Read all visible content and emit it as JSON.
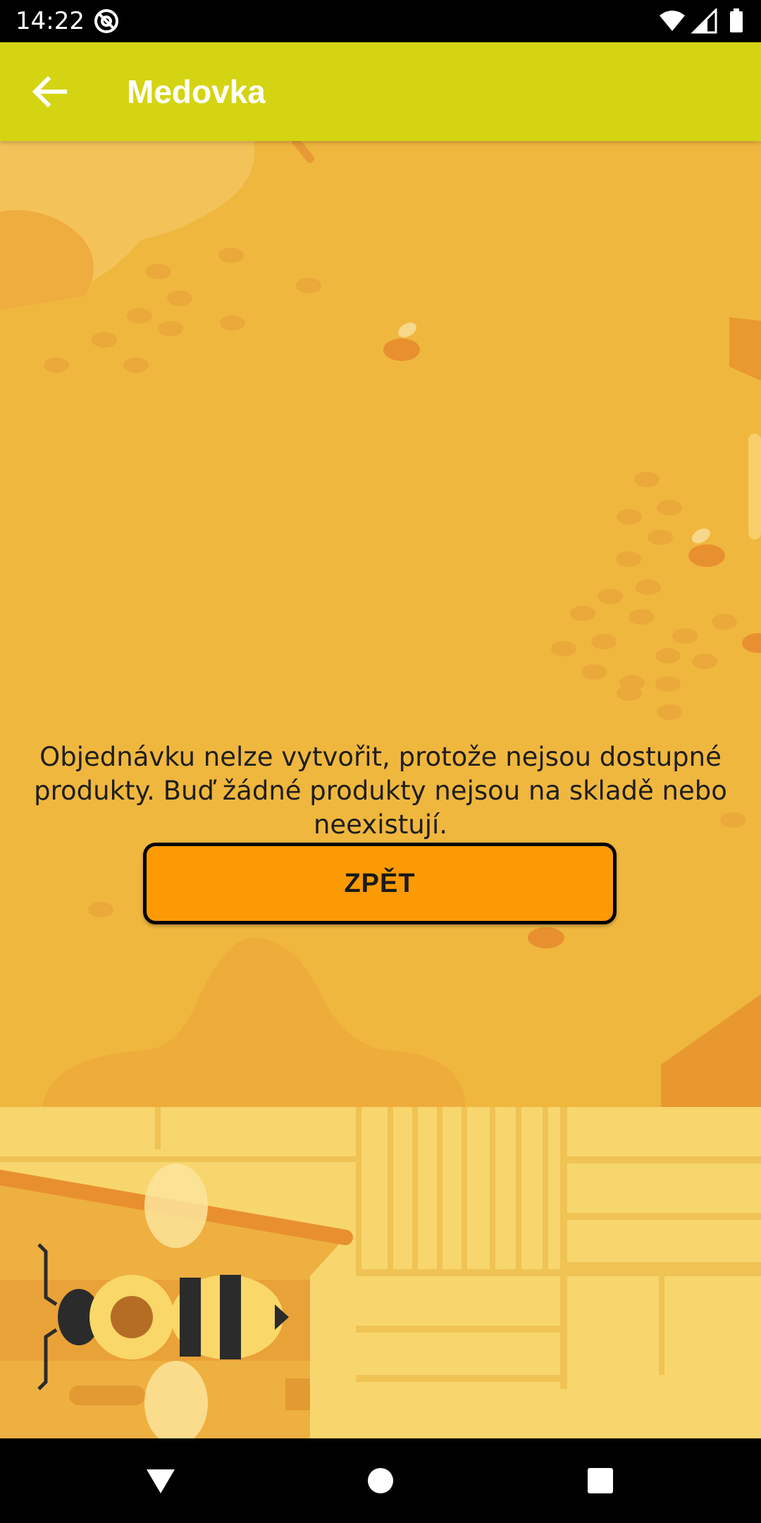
{
  "status_bar": {
    "time": "14:22"
  },
  "app_bar": {
    "title": "Medovka",
    "back_icon": "arrow-left-icon"
  },
  "content": {
    "message": "Objednávku nelze vytvořit, protože nejsou dostupné produkty. Buď žádné produkty nejsou na skladě nebo neexistují.",
    "back_button_label": "ZPĚT"
  },
  "nav_bar": {
    "icons": [
      "back-triangle-icon",
      "home-circle-icon",
      "recents-square-icon"
    ]
  },
  "colors": {
    "app_bar": "#d4d413",
    "background": "#f0b73e",
    "button": "#fc9a03",
    "button_border": "#000000",
    "text": "#1e1e1e"
  }
}
